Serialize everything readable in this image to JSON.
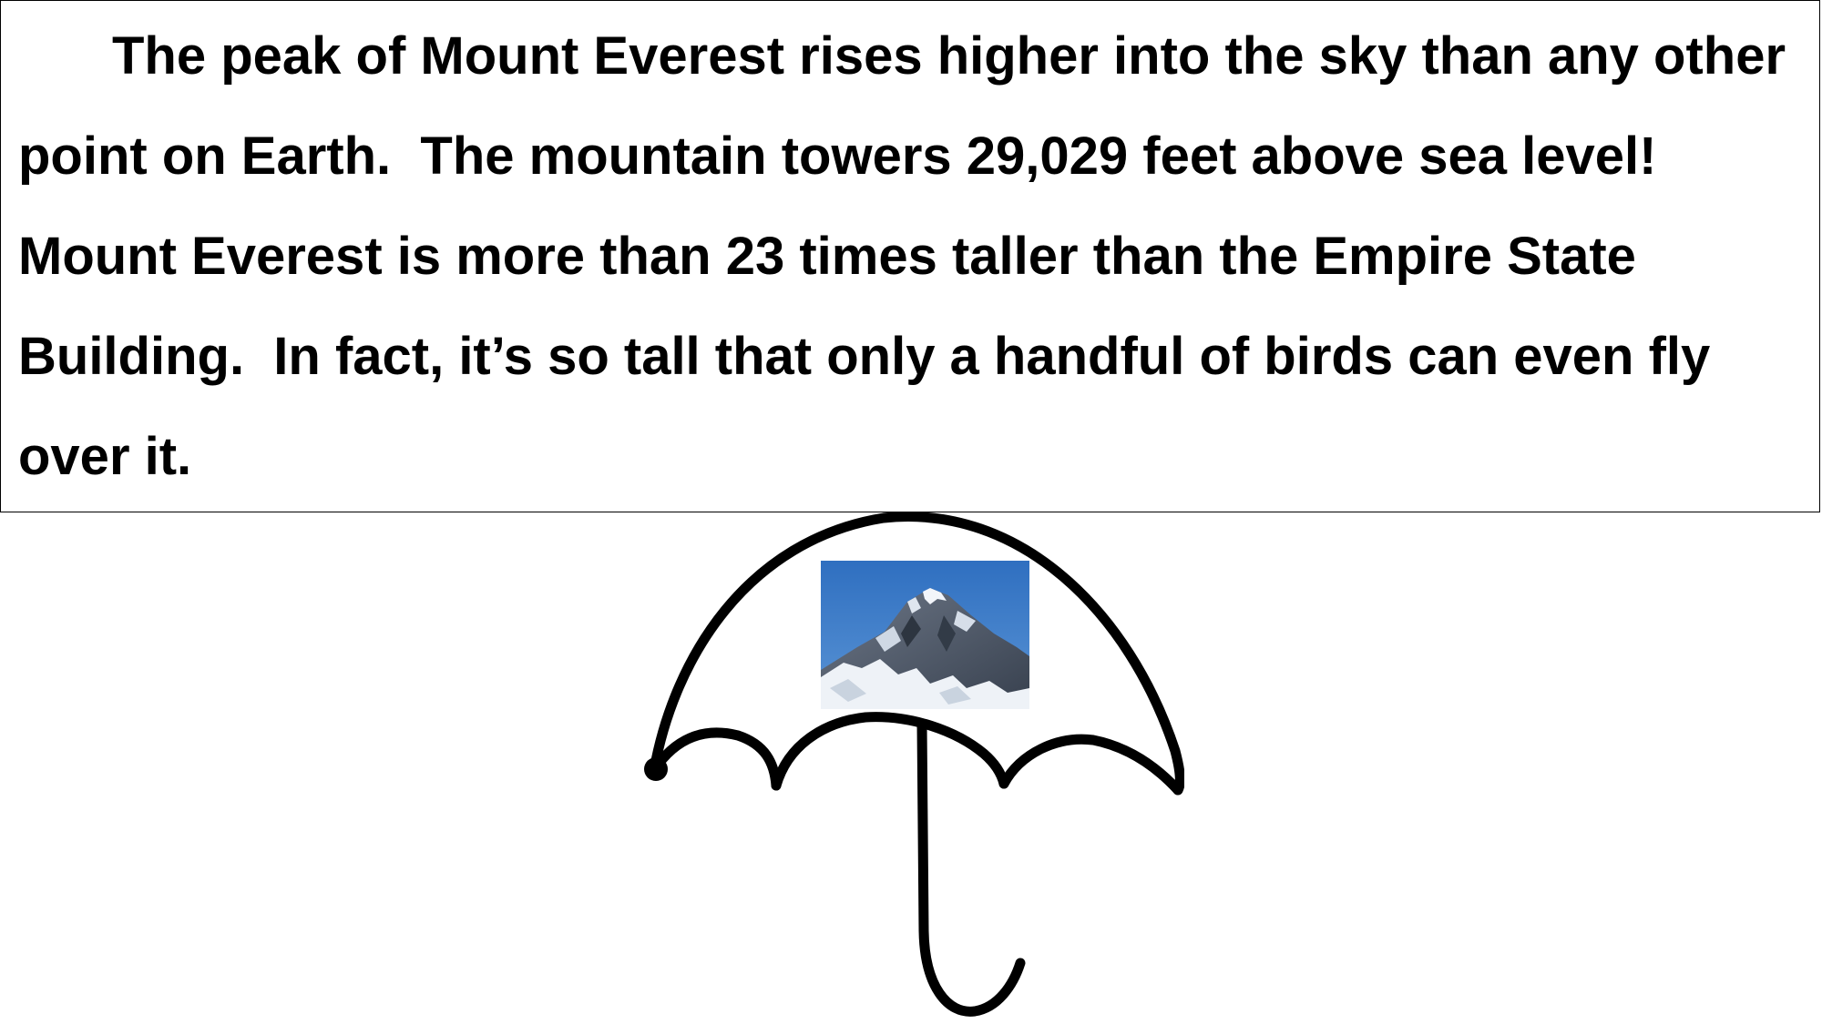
{
  "document": {
    "passage": "The peak of Mount Everest rises higher into the sky than any other point on Earth.  The mountain towers 29,029 feet above sea level!  Mount Everest is more than 23 times taller than the Empire State Building.  In fact, it’s so tall that only a handful of birds can even fly over it."
  },
  "illustration": {
    "umbrella_icon": "umbrella-icon",
    "photo_subject": "mountain-peak-photo",
    "colors": {
      "sky": "#3a78c4",
      "snow": "#eef2f7",
      "rock": "#4a5566",
      "ink": "#000000"
    }
  }
}
